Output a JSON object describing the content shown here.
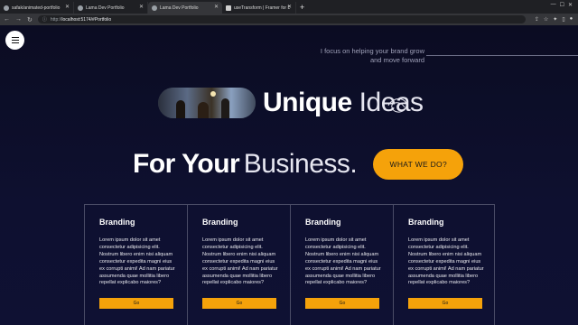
{
  "browser": {
    "tabs": [
      {
        "label": "safak/animated-portfolio",
        "active": false
      },
      {
        "label": "Lama Dev Portfolio",
        "active": false
      },
      {
        "label": "Lama Dev Portfolio",
        "active": true
      },
      {
        "label": "useTransform | Framer for Dev",
        "active": false
      }
    ],
    "new_tab": "+",
    "url_prefix": "http://",
    "url": "localhost:5174/#Portfolio"
  },
  "hero": {
    "focus_text": "I focus on helping your brand grow and move forward",
    "unique": "Unique",
    "ideas": "Ideas",
    "for_your": "For Your",
    "business": "Business.",
    "cta_label": "WHAT WE DO?"
  },
  "cards": [
    {
      "title": "Branding",
      "body": "Lorem ipsum dolor sit amet consectetur adipisicing elit. Nostrum libero enim nisi aliquam consectetur expedita magni eius ex corrupti animi! Ad nam pariatur assumenda quae mollitia libero repellat explicabo maiores?",
      "button": "Go"
    },
    {
      "title": "Branding",
      "body": "Lorem ipsum dolor sit amet consectetur adipisicing elit. Nostrum libero enim nisi aliquam consectetur expedita magni eius ex corrupti animi! Ad nam pariatur assumenda quae mollitia libero repellat explicabo maiores?",
      "button": "Go"
    },
    {
      "title": "Branding",
      "body": "Lorem ipsum dolor sit amet consectetur adipisicing elit. Nostrum libero enim nisi aliquam consectetur expedita magni eius ex corrupti animi! Ad nam pariatur assumenda quae mollitia libero repellat explicabo maiores?",
      "button": "Go"
    },
    {
      "title": "Branding",
      "body": "Lorem ipsum dolor sit amet consectetur adipisicing elit. Nostrum libero enim nisi aliquam consectetur expedita magni eius ex corrupti animi! Ad nam pariatur assumenda quae mollitia libero repellat explicabo maiores?",
      "button": "Go"
    }
  ],
  "colors": {
    "background": "#0b0c24",
    "accent": "#f5a20a",
    "card_border": "#4a4c66"
  },
  "icons": [
    "github-icon",
    "globe-icon",
    "framer-icon",
    "menu-icon",
    "back-arrow-icon",
    "forward-arrow-icon",
    "reload-icon",
    "info-icon"
  ]
}
